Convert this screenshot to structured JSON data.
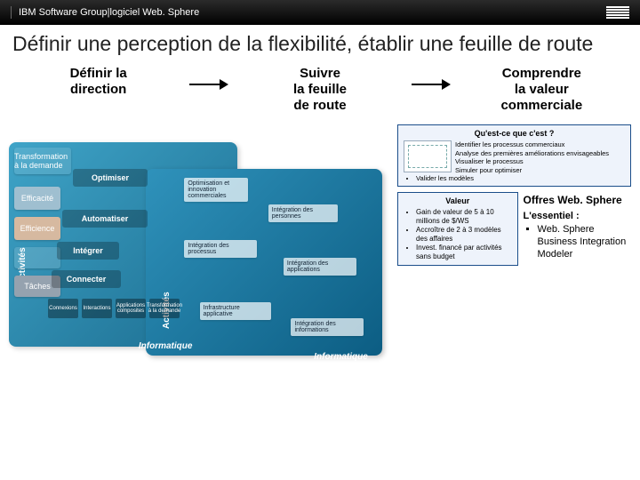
{
  "header": {
    "org": "IBM Software Group",
    "sep": " | ",
    "product": "logiciel Web. Sphere"
  },
  "title": "Définir une perception de la flexibilité, établir une feuille de route",
  "columns": {
    "c1l1": "Définir la",
    "c1l2": "direction",
    "c2l1": "Suivre",
    "c2l2": "la feuille",
    "c2l3": "de route",
    "c3l1": "Comprendre",
    "c3l2": "la valeur",
    "c3l3": "commerciale"
  },
  "diagram": {
    "axis1": "Activités",
    "axis2": "Activités",
    "steps": {
      "s1": "Transformation à la demande",
      "s2": "Efficacité",
      "s3": "Efficience",
      "s4": "",
      "s5": "Tâches"
    },
    "treads": {
      "t1": "Optimiser",
      "t2": "Automatiser",
      "t3": "Intégrer",
      "t4": "Connecter"
    },
    "boxes": {
      "b1": "Optimisation et innovation commerciales",
      "b2": "Intégration des personnes",
      "b3": "Intégration des processus",
      "b4": "Intégration des applications",
      "b5": "Infrastructure applicative",
      "b6": "Intégration des informations"
    },
    "small": {
      "sb1": "Connexions",
      "sb2": "Interactions",
      "sb3": "Applications composites",
      "sb4": "Transformation à la demande"
    },
    "foot1": "Informatique",
    "foot2": "Informatique"
  },
  "cards": {
    "top_heading": "Qu'est-ce que c'est ?",
    "top_items": [
      "Identifier les processus commerciaux",
      "Analyse des premières améliorations envisageables",
      "Visualiser le processus",
      "Simuler pour optimiser",
      "Valider les modèles"
    ],
    "val_heading": "Valeur",
    "val_items": [
      "Gain de valeur de 5 à 10 millions de $/WS",
      "Accroître de 2 à 3 modèles des affaires",
      "Invest. financé par activités sans budget"
    ]
  },
  "offers": {
    "title": "Offres Web. Sphere",
    "ess_label": "L'essentiel :",
    "ess_item": "Web. Sphere Business Integration Modeler"
  }
}
